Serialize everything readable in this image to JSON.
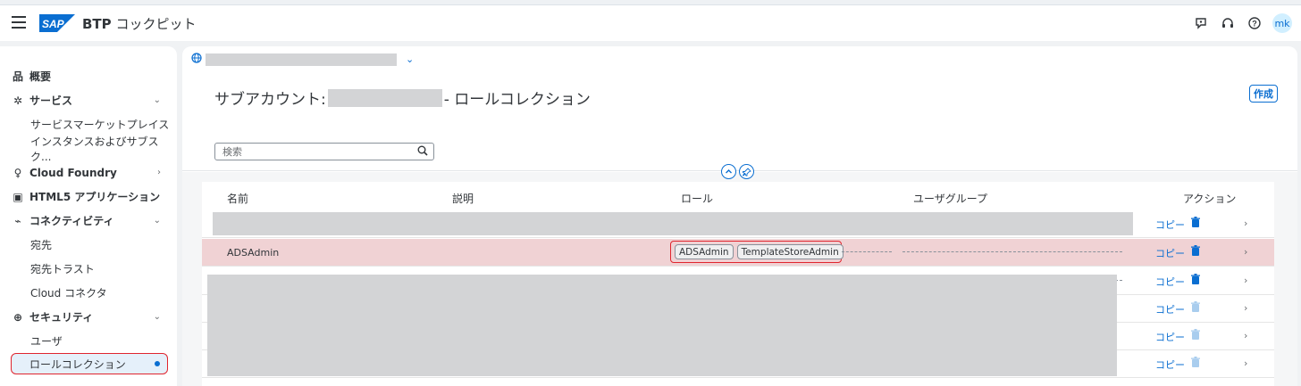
{
  "shell": {
    "product_bold": "BTP",
    "product_rest": " コックピット",
    "avatar_initials": "mk",
    "icons": [
      "feedback-icon",
      "support-headset-icon",
      "help-icon"
    ]
  },
  "sidebar": {
    "items": [
      {
        "label": "概要",
        "icon": "hierarchy-icon",
        "level": 0
      },
      {
        "label": "サービス",
        "icon": "puzzle-icon",
        "level": 0,
        "chevron": "down"
      },
      {
        "label": "サービスマーケットプレイス",
        "level": 1
      },
      {
        "label": "インスタンスおよびサブスク...",
        "level": 1
      },
      {
        "label": "Cloud Foundry",
        "icon": "cloud-foundry-icon",
        "level": 0,
        "chevron": "right"
      },
      {
        "label": "HTML5 アプリケーション",
        "icon": "html5-icon",
        "level": 0
      },
      {
        "label": "コネクティビティ",
        "icon": "connectivity-icon",
        "level": 0,
        "chevron": "down"
      },
      {
        "label": "宛先",
        "level": 1
      },
      {
        "label": "宛先トラスト",
        "level": 1
      },
      {
        "label": "Cloud コネクタ",
        "level": 1
      },
      {
        "label": "セキュリティ",
        "icon": "security-icon",
        "level": 0,
        "chevron": "down"
      },
      {
        "label": "ユーザ",
        "level": 1
      },
      {
        "label": "ロールコレクション",
        "level": 1,
        "selected": true
      }
    ]
  },
  "header": {
    "title_prefix": "サブアカウント:",
    "title_suffix": " - ロールコレクション",
    "create_label": "作成",
    "search_placeholder": "検索"
  },
  "table": {
    "columns": [
      "名前",
      "説明",
      "ロール",
      "ユーザグループ",
      "アクション"
    ],
    "highlighted_row": {
      "name": "ADSAdmin",
      "roles": [
        "ADSAdmin",
        "TemplateStoreAdmin"
      ]
    },
    "copy_label": "コピー"
  },
  "colors": {
    "accent": "#0a6ed1",
    "highlight_row": "#f0d2d4",
    "annotation_red": "#e0252e"
  }
}
